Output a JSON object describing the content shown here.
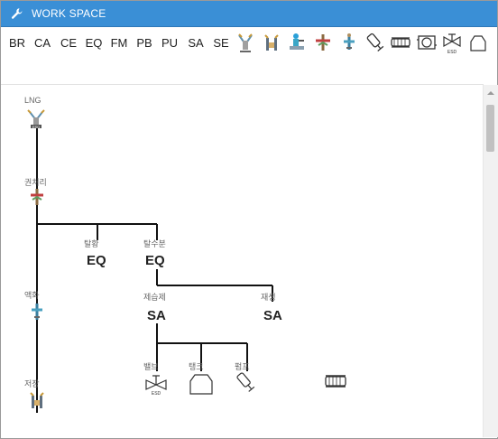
{
  "window": {
    "title": "WORK SPACE",
    "title_icon": "wrench-icon"
  },
  "toolbar": {
    "buttons": [
      "BR",
      "CA",
      "CE",
      "EQ",
      "FM",
      "PB",
      "PU",
      "SA",
      "SE"
    ],
    "icons": [
      "pillar-lng-icon",
      "gate-icon",
      "reactor-icon",
      "distributor-icon",
      "sprayer-icon",
      "tilted-valve-icon",
      "heat-exchanger-icon",
      "drum-unit-icon",
      "esd-valve-icon",
      "tank-icon"
    ]
  },
  "diagram": {
    "trunk_nodes": [
      {
        "label": "LNG",
        "icon": "lng-station-icon"
      },
      {
        "label": "권처리",
        "icon": "distributor-icon"
      },
      {
        "label": "액화",
        "icon": "sprayer-icon"
      },
      {
        "label": "저장",
        "icon": "gate-icon"
      }
    ],
    "eq_nodes": [
      {
        "label": "탈황",
        "type": "EQ"
      },
      {
        "label": "탈수분",
        "type": "EQ"
      }
    ],
    "sa_nodes": [
      {
        "label": "제습제",
        "type": "SA"
      },
      {
        "label": "재생",
        "type": "SA"
      }
    ],
    "leaf_nodes": [
      {
        "label": "밸브",
        "icon": "esd-valve-icon"
      },
      {
        "label": "탱크",
        "icon": "tank-icon"
      },
      {
        "label": "펌프",
        "icon": "tilted-valve-icon"
      }
    ],
    "floating_icon": "heat-exchanger-icon"
  },
  "colors": {
    "titlebar": "#3a8fd6",
    "line": "#111111"
  }
}
